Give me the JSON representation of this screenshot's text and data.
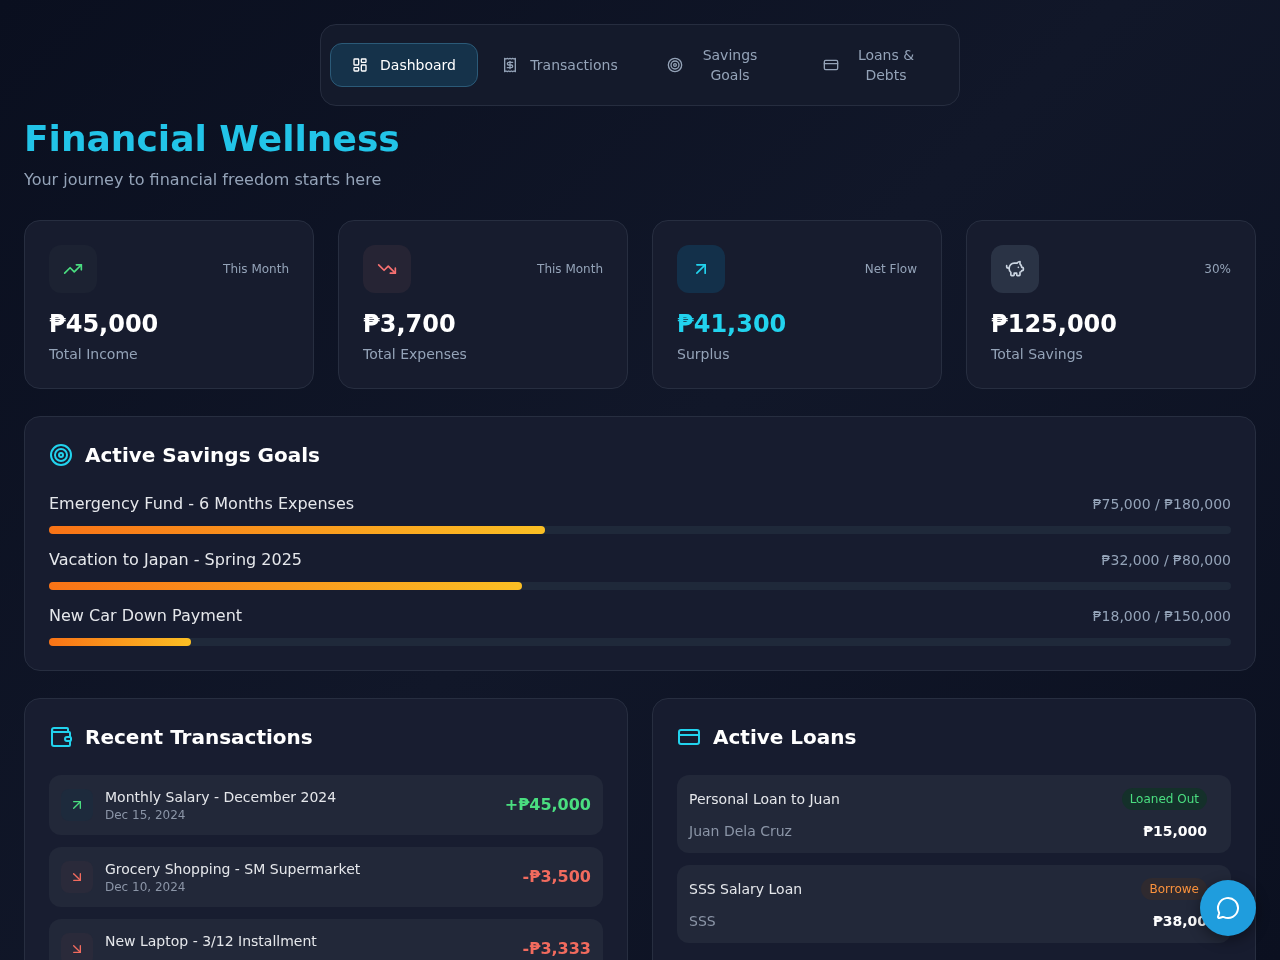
{
  "nav": {
    "tabs": [
      {
        "label": "Dashboard",
        "selected": true
      },
      {
        "label": "Transactions",
        "selected": false
      },
      {
        "label": "Savings Goals",
        "selected": false
      },
      {
        "label": "Loans & Debts",
        "selected": false
      }
    ]
  },
  "header": {
    "title": "Financial Wellness",
    "subtitle": "Your journey to financial freedom starts here"
  },
  "stats": [
    {
      "kind": "income",
      "caption": "This Month",
      "value": "₱45,000",
      "label": "Total Income"
    },
    {
      "kind": "expense",
      "caption": "This Month",
      "value": "₱3,700",
      "label": "Total Expenses"
    },
    {
      "kind": "surplus",
      "caption": "Net Flow",
      "value": "₱41,300",
      "label": "Surplus"
    },
    {
      "kind": "savings",
      "caption": "30%",
      "value": "₱125,000",
      "label": "Total Savings"
    }
  ],
  "savings_goals": {
    "title": "Active Savings Goals",
    "goals": [
      {
        "name": "Emergency Fund - 6 Months Expenses",
        "amount": "₱75,000 / ₱180,000",
        "level": 0.42
      },
      {
        "name": "Vacation to Japan - Spring 2025",
        "amount": "₱32,000 / ₱80,000",
        "level": 0.4
      },
      {
        "name": "New Car Down Payment",
        "amount": "₱18,000 / ₱150,000",
        "level": 0.12
      }
    ]
  },
  "recent_transactions": {
    "title": "Recent Transactions",
    "items": [
      {
        "kind": "income",
        "title": "Monthly Salary - December 2024",
        "date": "Dec 15, 2024",
        "amount": "+₱45,000"
      },
      {
        "kind": "expense",
        "title": "Grocery Shopping - SM Supermarket",
        "date": "Dec 10, 2024",
        "amount": "-₱3,500"
      },
      {
        "kind": "expense",
        "title": "New Laptop - 3/12 Installment",
        "amount": "-₱3,333"
      }
    ]
  },
  "active_loans": {
    "title": "Active Loans",
    "items": [
      {
        "kind": "loaned_out",
        "name": "Personal Loan to Juan",
        "badge": "Loaned Out",
        "person": "Juan Dela Cruz",
        "amount": "₱15,000"
      },
      {
        "kind": "borrowed",
        "name": "SSS Salary Loan",
        "badge": "Borrowe",
        "person": "SSS",
        "amount": "₱38,00"
      }
    ]
  }
}
